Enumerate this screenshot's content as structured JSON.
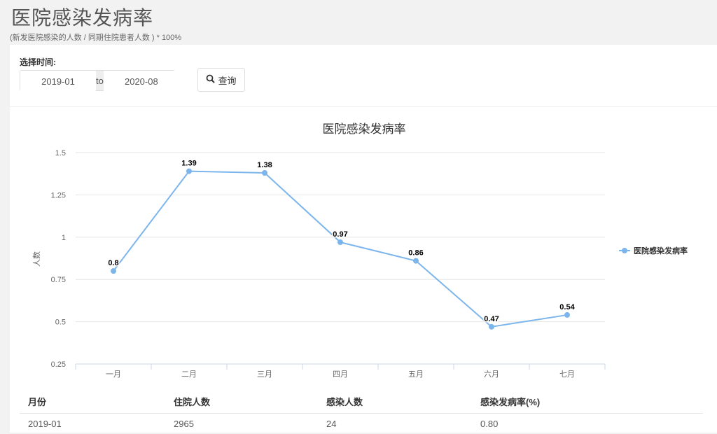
{
  "header": {
    "title": "医院感染发病率",
    "formula": "(新发医院感染的人数 / 同期住院患者人数 ) * 100%"
  },
  "filter": {
    "label": "选择时间:",
    "start": "2019-01",
    "separator": "to",
    "end": "2020-08",
    "search_label": "查询",
    "search_icon": "search-icon"
  },
  "chart_data": {
    "type": "line",
    "title": "医院感染发病率",
    "ylabel": "人数",
    "xlabel": "",
    "categories": [
      "一月",
      "二月",
      "三月",
      "四月",
      "五月",
      "六月",
      "七月"
    ],
    "series": [
      {
        "name": "医院感染发病率",
        "values": [
          0.8,
          1.39,
          1.38,
          0.97,
          0.86,
          0.47,
          0.54
        ],
        "color": "#7cb5ec"
      }
    ],
    "ylim": [
      0.25,
      1.5
    ],
    "yticks": [
      0.25,
      0.5,
      0.75,
      1,
      1.25,
      1.5
    ],
    "ytick_labels": [
      "0.25",
      "0.5",
      "0.75",
      "1",
      "1.25",
      "1.5"
    ],
    "grid": true,
    "legend": "right"
  },
  "table": {
    "columns": [
      "月份",
      "住院人数",
      "感染人数",
      "感染发病率(%)"
    ],
    "rows": [
      [
        "2019-01",
        "2965",
        "24",
        "0.80"
      ]
    ]
  }
}
